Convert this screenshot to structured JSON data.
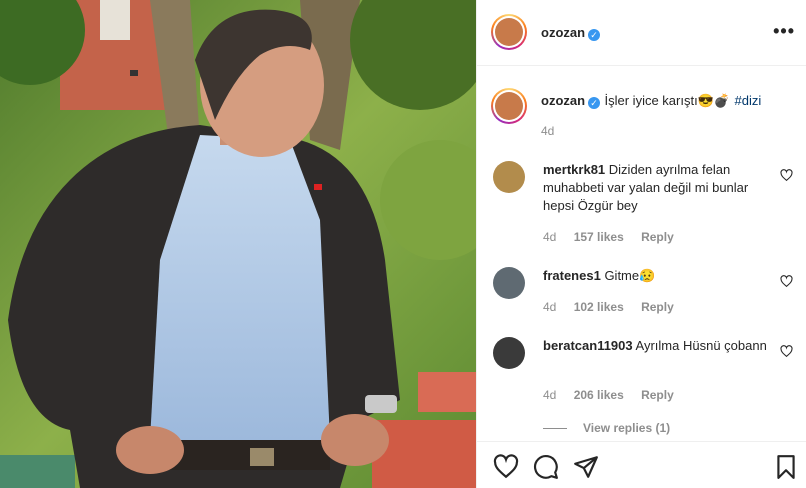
{
  "post": {
    "username": "ozozan",
    "verified_mark": "✓",
    "more_icon": "•••",
    "caption": {
      "username": "ozozan",
      "text": "İşler iyice karıştı😎💣",
      "hashtag": "#dizi",
      "age": "4d"
    }
  },
  "comments": [
    {
      "username": "mertkrk81",
      "text": "Diziden ayrılma felan muhabbeti var yalan değil mi bunlar hepsi Özgür bey",
      "age": "4d",
      "likes": "157 likes",
      "reply": "Reply"
    },
    {
      "username": "fratenes1",
      "text": "Gitme😥",
      "age": "4d",
      "likes": "102 likes",
      "reply": "Reply"
    },
    {
      "username": "beratcan11903",
      "text": "Ayrılma Hüsnü çobann",
      "age": "4d",
      "likes": "206 likes",
      "reply": "Reply",
      "view_replies": "View replies (1)"
    }
  ],
  "actions": {
    "like_icon": "heart-icon",
    "comment_icon": "comment-icon",
    "share_icon": "share-icon",
    "save_icon": "bookmark-icon"
  },
  "colors": {
    "link": "#00376b",
    "verified": "#3897f0",
    "muted": "#8e8e8e"
  }
}
